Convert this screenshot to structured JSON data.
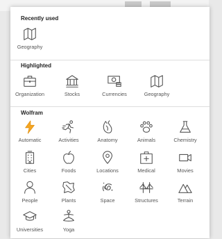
{
  "sections": {
    "recent": {
      "title": "Recently used",
      "items": [
        {
          "label": "Geography",
          "icon": "map-icon"
        }
      ]
    },
    "highlighted": {
      "title": "Highlighted",
      "items": [
        {
          "label": "Organization",
          "icon": "briefcase-icon"
        },
        {
          "label": "Stocks",
          "icon": "bank-icon"
        },
        {
          "label": "Currencies",
          "icon": "money-icon"
        },
        {
          "label": "Geography",
          "icon": "map-icon"
        }
      ]
    },
    "wolfram": {
      "title": "Wolfram",
      "items": [
        {
          "label": "Automatic",
          "icon": "lightning-icon"
        },
        {
          "label": "Activities",
          "icon": "running-icon"
        },
        {
          "label": "Anatomy",
          "icon": "anatomy-icon"
        },
        {
          "label": "Animals",
          "icon": "paw-icon"
        },
        {
          "label": "Chemistry",
          "icon": "flask-icon"
        },
        {
          "label": "Cities",
          "icon": "building-icon"
        },
        {
          "label": "Foods",
          "icon": "apple-icon"
        },
        {
          "label": "Locations",
          "icon": "pin-icon"
        },
        {
          "label": "Medical",
          "icon": "medical-kit-icon"
        },
        {
          "label": "Movies",
          "icon": "video-camera-icon"
        },
        {
          "label": "People",
          "icon": "person-icon"
        },
        {
          "label": "Plants",
          "icon": "leaf-icon"
        },
        {
          "label": "Space",
          "icon": "galaxy-icon"
        },
        {
          "label": "Structures",
          "icon": "bridge-icon"
        },
        {
          "label": "Terrain",
          "icon": "mountains-icon"
        },
        {
          "label": "Universities",
          "icon": "graduation-cap-icon"
        },
        {
          "label": "Yoga",
          "icon": "yoga-icon"
        }
      ]
    }
  },
  "colors": {
    "accent": "#f5a623",
    "icon": "#555555",
    "label": "#555555"
  }
}
